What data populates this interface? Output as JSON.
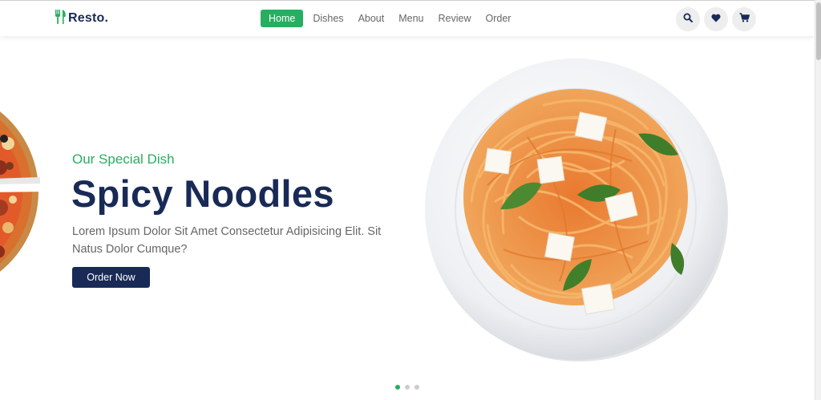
{
  "header": {
    "logo_text": "Resto.",
    "nav": [
      "Home",
      "Dishes",
      "About",
      "Menu",
      "Review",
      "Order"
    ],
    "active_nav": "Home",
    "icons": [
      "search-icon",
      "heart-icon",
      "cart-icon"
    ]
  },
  "hero": {
    "subtitle": "Our Special Dish",
    "title": "Spicy Noodles",
    "description": "Lorem Ipsum Dolor Sit Amet Consectetur Adipisicing Elit. Sit Natus Dolor Cumque?",
    "button_label": "Order Now",
    "slides_count": 3,
    "active_slide": 1
  },
  "colors": {
    "accent": "#27ae60",
    "dark": "#192a56",
    "text": "#666666"
  }
}
